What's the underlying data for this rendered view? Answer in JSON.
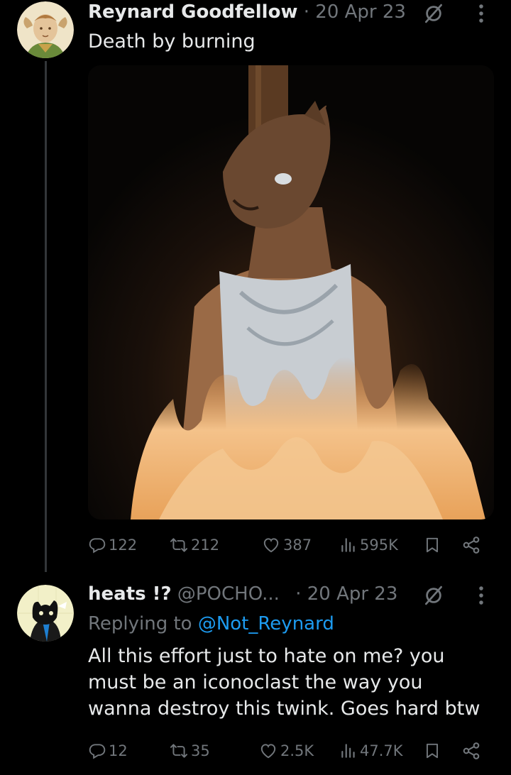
{
  "tweet1": {
    "display_name": "Reynard Goodfellow",
    "separator": "·",
    "date": "20 Apr 23",
    "text": "Death by burning",
    "stats": {
      "replies": "122",
      "reposts": "212",
      "likes": "387",
      "views": "595K"
    }
  },
  "tweet2": {
    "display_name": "heats !?",
    "handle": "@POCHO...",
    "separator": "·",
    "date": "20 Apr 23",
    "replying_prefix": "Replying to",
    "replying_to": "@Not_Reynard",
    "text_lines": [
      "All this effort just to hate on me? you",
      "must be an iconoclast the way you",
      "wanna destroy this twink. Goes hard btw"
    ],
    "stats": {
      "replies": "12",
      "reposts": "35",
      "likes": "2.5K",
      "views": "47.7K"
    }
  },
  "icons": [
    "grok-icon",
    "more-icon",
    "reply-icon",
    "repost-icon",
    "like-icon",
    "views-icon",
    "bookmark-icon",
    "share-icon"
  ],
  "colors": {
    "background": "#000000",
    "text": "#e7e9ea",
    "muted": "#71767b",
    "link": "#1d9bf0",
    "divider": "#333639"
  }
}
